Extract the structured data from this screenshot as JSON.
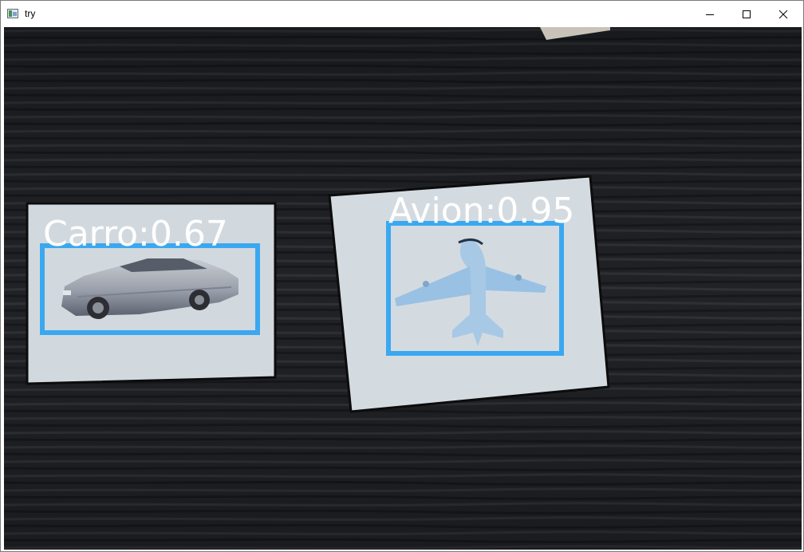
{
  "window": {
    "title": "try",
    "icon": "window-app-icon",
    "controls": [
      "minimize-icon",
      "maximize-icon",
      "close-icon"
    ]
  },
  "detections": [
    {
      "label": "Carro:0.67",
      "object": "car-image",
      "box_color": "#3aa8f0"
    },
    {
      "label": "Avion:0.95",
      "object": "airplane-image",
      "box_color": "#3aa8f0"
    }
  ],
  "colors": {
    "background": "#1d1f22",
    "card": "#d6dde2",
    "label_text": "#ffffff"
  }
}
